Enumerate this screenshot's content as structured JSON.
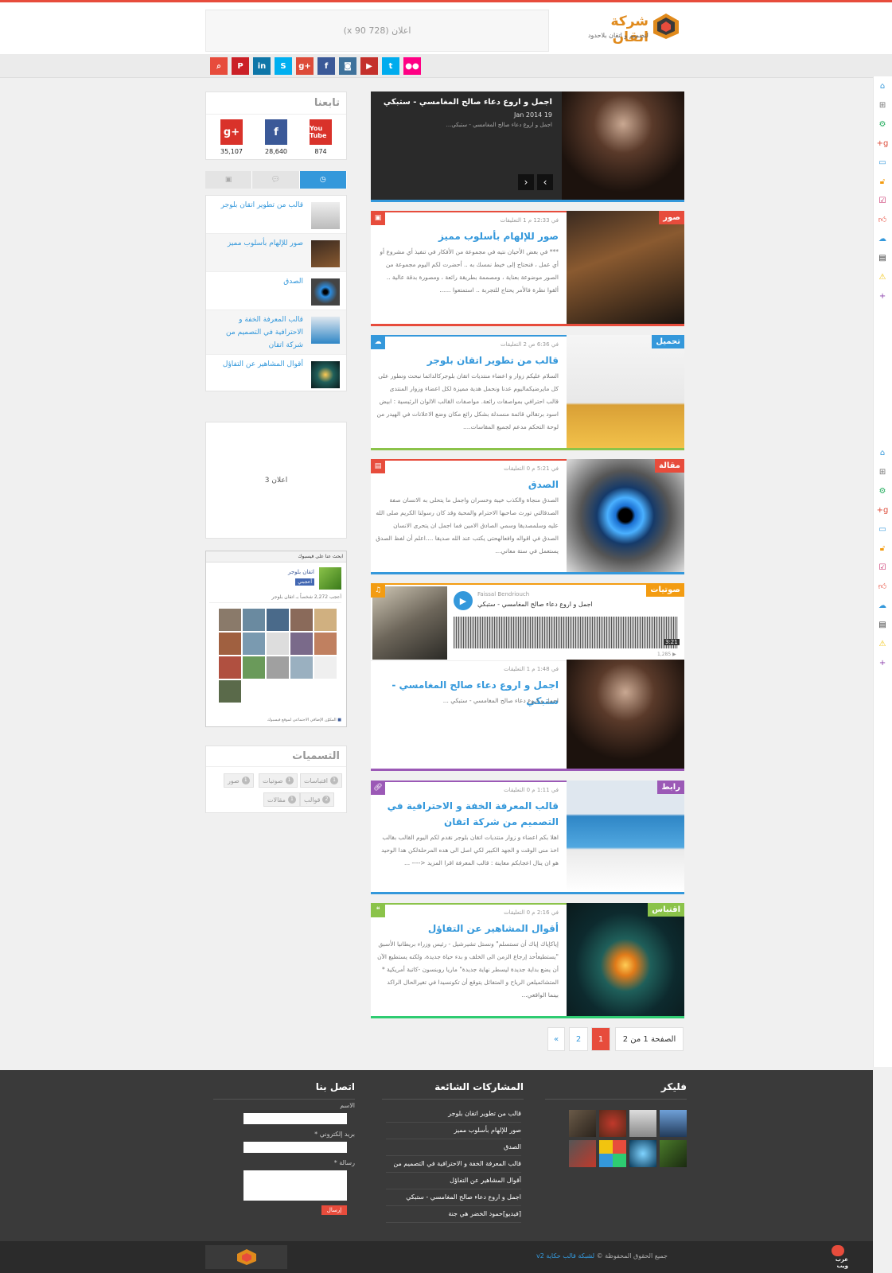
{
  "header": {
    "logo_title": "شركة اتقان",
    "logo_tagline": "لتصميم و اتقان بلاحدود",
    "ad_text": "اعلان (728 x 90)"
  },
  "social_top": [
    {
      "name": "search-icon",
      "glyph": "⌕",
      "color": "#e74c3c"
    },
    {
      "name": "pinterest-icon",
      "glyph": "P",
      "color": "#cb2027"
    },
    {
      "name": "linkedin-icon",
      "glyph": "in",
      "color": "#0e76a8"
    },
    {
      "name": "skype-icon",
      "glyph": "S",
      "color": "#00aff0"
    },
    {
      "name": "googleplus-icon",
      "glyph": "g+",
      "color": "#dd4b39"
    },
    {
      "name": "facebook-icon",
      "glyph": "f",
      "color": "#3b5998"
    },
    {
      "name": "instagram-icon",
      "glyph": "◙",
      "color": "#3f729b"
    },
    {
      "name": "youtube-icon",
      "glyph": "▶",
      "color": "#c4302b"
    },
    {
      "name": "twitter-icon",
      "glyph": "t",
      "color": "#00acee"
    },
    {
      "name": "flickr-icon",
      "glyph": "●●",
      "color": "#ff0084"
    }
  ],
  "slider": {
    "title": "اجمل و اروع دعاء صالح المغامسي - ستبكي",
    "date": "19 Jan 2014",
    "excerpt": "اجمل و اروع دعاء صالح المغامسي - ستبكي..."
  },
  "posts": [
    {
      "category": "صور",
      "color": "#e74c3c",
      "title": "صور للإلهام بأسلوب مميز",
      "meta": "في 12:33 م   1 التعليقات",
      "excerpt": "*** في بعض الأحيان نتيه في مجموعة من الأفكار في تنفيذ أي مشروع أو أي عمل ، فنحتاج إلى خيط نمسك به .. أحضرت لكم اليوم مجموعة من الصور موضوعة بعناية ، ومصممة بطريقة رائعة ، ومصورة بدقة عالية .. ألقوا نظرة فالأمر يحتاج للتجربة .. استمتعوا ......"
    },
    {
      "category": "تحميل",
      "color": "#3498db",
      "title": "قالب من تطوير اتقان بلوجر",
      "meta": "في 6:36 ص   2 التعليقات",
      "excerpt": "السلام عليكم زوار و اعضاء منتديات اتقان بلوجركالدائما نبحث ونطور على كل مايرضيكماليوم عدنا ونحمل هدية مميزة لكل اعضاء وزوار المنتدى قالب احترافي بمواصفات رائعة. مواصفات القالب الالوان الرئيسية : ابيض اسود برتقالي قائمة منسدلة بشكل رائع مكان وضع الاعلانات في الهيدر من لوحة التحكم مدعم لجميع المقاسات...."
    },
    {
      "category": "مقالة",
      "color": "#e74c3c",
      "title": "الصدق",
      "meta": "في 5:21 م   0 التعليقات",
      "excerpt": "الصدق منجاة والكذب خيبة وخسران واجمل ما يتحلى به الانسان صفة الصدقالتي تورث صاحبها الاحترام والمحبة وقد كان رسولنا الكريم صلى الله عليه وسلمصديقا وسمي الصادق الامين فما اجمل ان يتحرى الانسان الصدق في اقواله وافعالهحتى يكتب عند الله صديقا ....اعلم أن لفظ الصدق يستعمل في ستة معاني..."
    },
    {
      "category": "صوتيات",
      "color": "#f39c12",
      "title": "اجمل و اروع دعاء صالح المغامسي - ستبكي",
      "meta": "في 1:48 م   1 التعليقات",
      "excerpt": "اجمل و اروع دعاء صالح المغامسي - ستبكي ..."
    },
    {
      "category": "رابط",
      "color": "#9b59b6",
      "title": "قالب المعرفة الخفة و الاحترافية في التصميم من شركة اتقان",
      "meta": "في 1:11 م   0 التعليقات",
      "excerpt": "اهلا بكم اعضاء و زوار منتديات اتقان بلوجر نقدم لكم اليوم القالب بقالب اخذ منى الوقت و الجهد الكبير لكي اصل الى هده المرحلةلكن هدا الوحيد هو ان ينال اعجابكم معاينة : قالب المعرفة اقرا المزيد <---- ..."
    },
    {
      "category": "اقتباس",
      "color": "#8bc34a",
      "title": "أقوال المشاهير عن التفاؤل",
      "meta": "في 2:16 م   0 التعليقات",
      "excerpt": "إياكإياك إياك أن تستسلم\" ونستل تشيرشيل - رئيس وزراء بريطانيا الأسبق \"يستطيعأحد إرجاع الزمن الى الخلف و بدء حياة جديدة، ولكنه يستطيع الآن أن يضع بداية جديدة ليسطر نهاية جديدة\" ماريا روبنسون -كاتبة أمريكية * المتشائميلعن الرياح و المتفائل يتوقع أن تكونسيدا في تغيرالحال الراكد بينما الواقعي..."
    }
  ],
  "soundcloud": {
    "author": "Faissal Bendriouch",
    "title": "اجمل و اروع دعاء صالح المغامسي - ستبكي",
    "duration": "3:21",
    "plays": "▶ 1,285",
    "source": "sou"
  },
  "sidebar": {
    "follow_title": "تابعنا",
    "follow": [
      {
        "name": "youtube",
        "label": "You Tube",
        "count": "874",
        "color": "#d9322a"
      },
      {
        "name": "facebook",
        "label": "f",
        "count": "28,640",
        "color": "#3b5998"
      },
      {
        "name": "googleplus",
        "label": "g+",
        "count": "35,107",
        "color": "#d9322a"
      }
    ],
    "recent": [
      {
        "title": "قالب من تطوير اتقان بلوجر"
      },
      {
        "title": "صور للإلهام بأسلوب مميز"
      },
      {
        "title": "الصدق"
      },
      {
        "title": "قالب المعرفة الخفة و الاحترافية في التصميم من شركة اتقان"
      },
      {
        "title": "أقوال المشاهير عن التفاؤل"
      }
    ],
    "ad3": "اعلان 3",
    "fb": {
      "header": "ابحث عنا على فيسبوك",
      "page_name": "اتقان بلوجر",
      "like": "أعجبني",
      "likes_text": "أعجب 2,272 شخصاً بـ اتقان بلوجر",
      "plugin": "المكوّن الإضافي الاجتماعي لموقع فيسبوك"
    },
    "labels_title": "التسميات",
    "labels": [
      {
        "label": "اقتباسات",
        "count": "1"
      },
      {
        "label": "صوتيات",
        "count": "1"
      },
      {
        "label": "صور",
        "count": "1"
      },
      {
        "label": "قوالب",
        "count": "2"
      },
      {
        "label": "مقالات",
        "count": "1"
      }
    ]
  },
  "pager": {
    "info": "الصفحة 1 من 2",
    "p1": "1",
    "p2": "2",
    "next": "»"
  },
  "footer": {
    "flickr_title": "فليكر",
    "popular_title": "المشاركات الشائعة",
    "popular": [
      "قالب من تطوير اتقان بلوجر",
      "صور للإلهام بأسلوب مميز",
      "الصدق",
      "قالب المعرفة الخفة و الاحترافية في التصميم من",
      "أقوال المشاهير عن التفاؤل",
      "اجمل و اروع دعاء صالح المغامسي - ستبكي",
      "[فيديو]حمود الخضر هي جنة"
    ],
    "contact_title": "اتصل بنا",
    "name_label": "الاسم",
    "email_label": "بريد إلكتروني *",
    "message_label": "رسالة *",
    "send": "إرسال",
    "copyright": "جميع الحقوق المحفوظة ©",
    "copyright_link": "لشبكة قالب حكاية v2",
    "badge_text": "عرب ويب"
  },
  "colors": {
    "accent": "#3498db",
    "brand": "#e74c3c"
  }
}
